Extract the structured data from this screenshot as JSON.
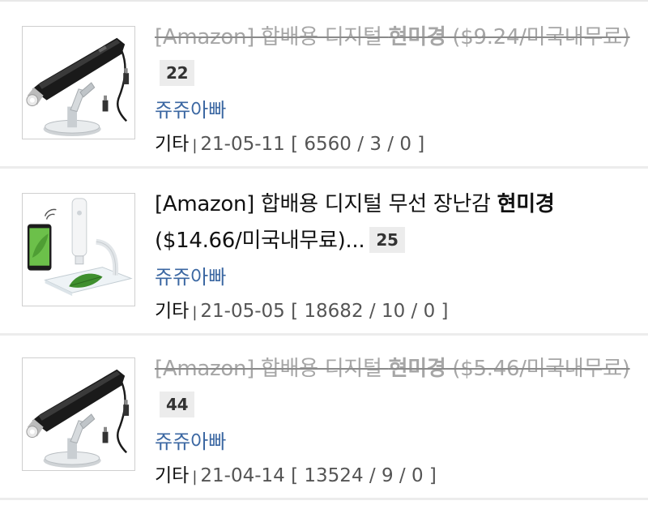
{
  "posts": [
    {
      "title_prefix": "[Amazon] 합배용 디지털 ",
      "title_highlight": "현미경",
      "title_suffix": " ($9.24/미국내무료)",
      "comments": "22",
      "author": "쥬쥬아빠",
      "category": "기타",
      "date": "21-05-11",
      "stats": "[ 6560 / 3 / 0 ]",
      "sold_out": true,
      "image": "black-usb-microscope"
    },
    {
      "title_prefix": "[Amazon] 합배용 디지털 무선 장난감 ",
      "title_highlight": "현미경",
      "title_suffix": " ($14.66/미국내무료)...",
      "comments": "25",
      "author": "쥬쥬아빠",
      "category": "기타",
      "date": "21-05-05",
      "stats": "[ 18682 / 10 / 0 ]",
      "sold_out": false,
      "image": "white-wireless-microscope"
    },
    {
      "title_prefix": "[Amazon] 합배용 디지털 ",
      "title_highlight": "현미경",
      "title_suffix": " ($5.46/미국내무료)",
      "comments": "44",
      "author": "쥬쥬아빠",
      "category": "기타",
      "date": "21-04-14",
      "stats": "[ 13524 / 9 / 0 ]",
      "sold_out": true,
      "image": "black-usb-microscope"
    }
  ],
  "colors": {
    "author": "#3b67a2",
    "sold_title": "#a6a6a6",
    "badge_bg": "#ececec",
    "divider": "#ececec"
  }
}
